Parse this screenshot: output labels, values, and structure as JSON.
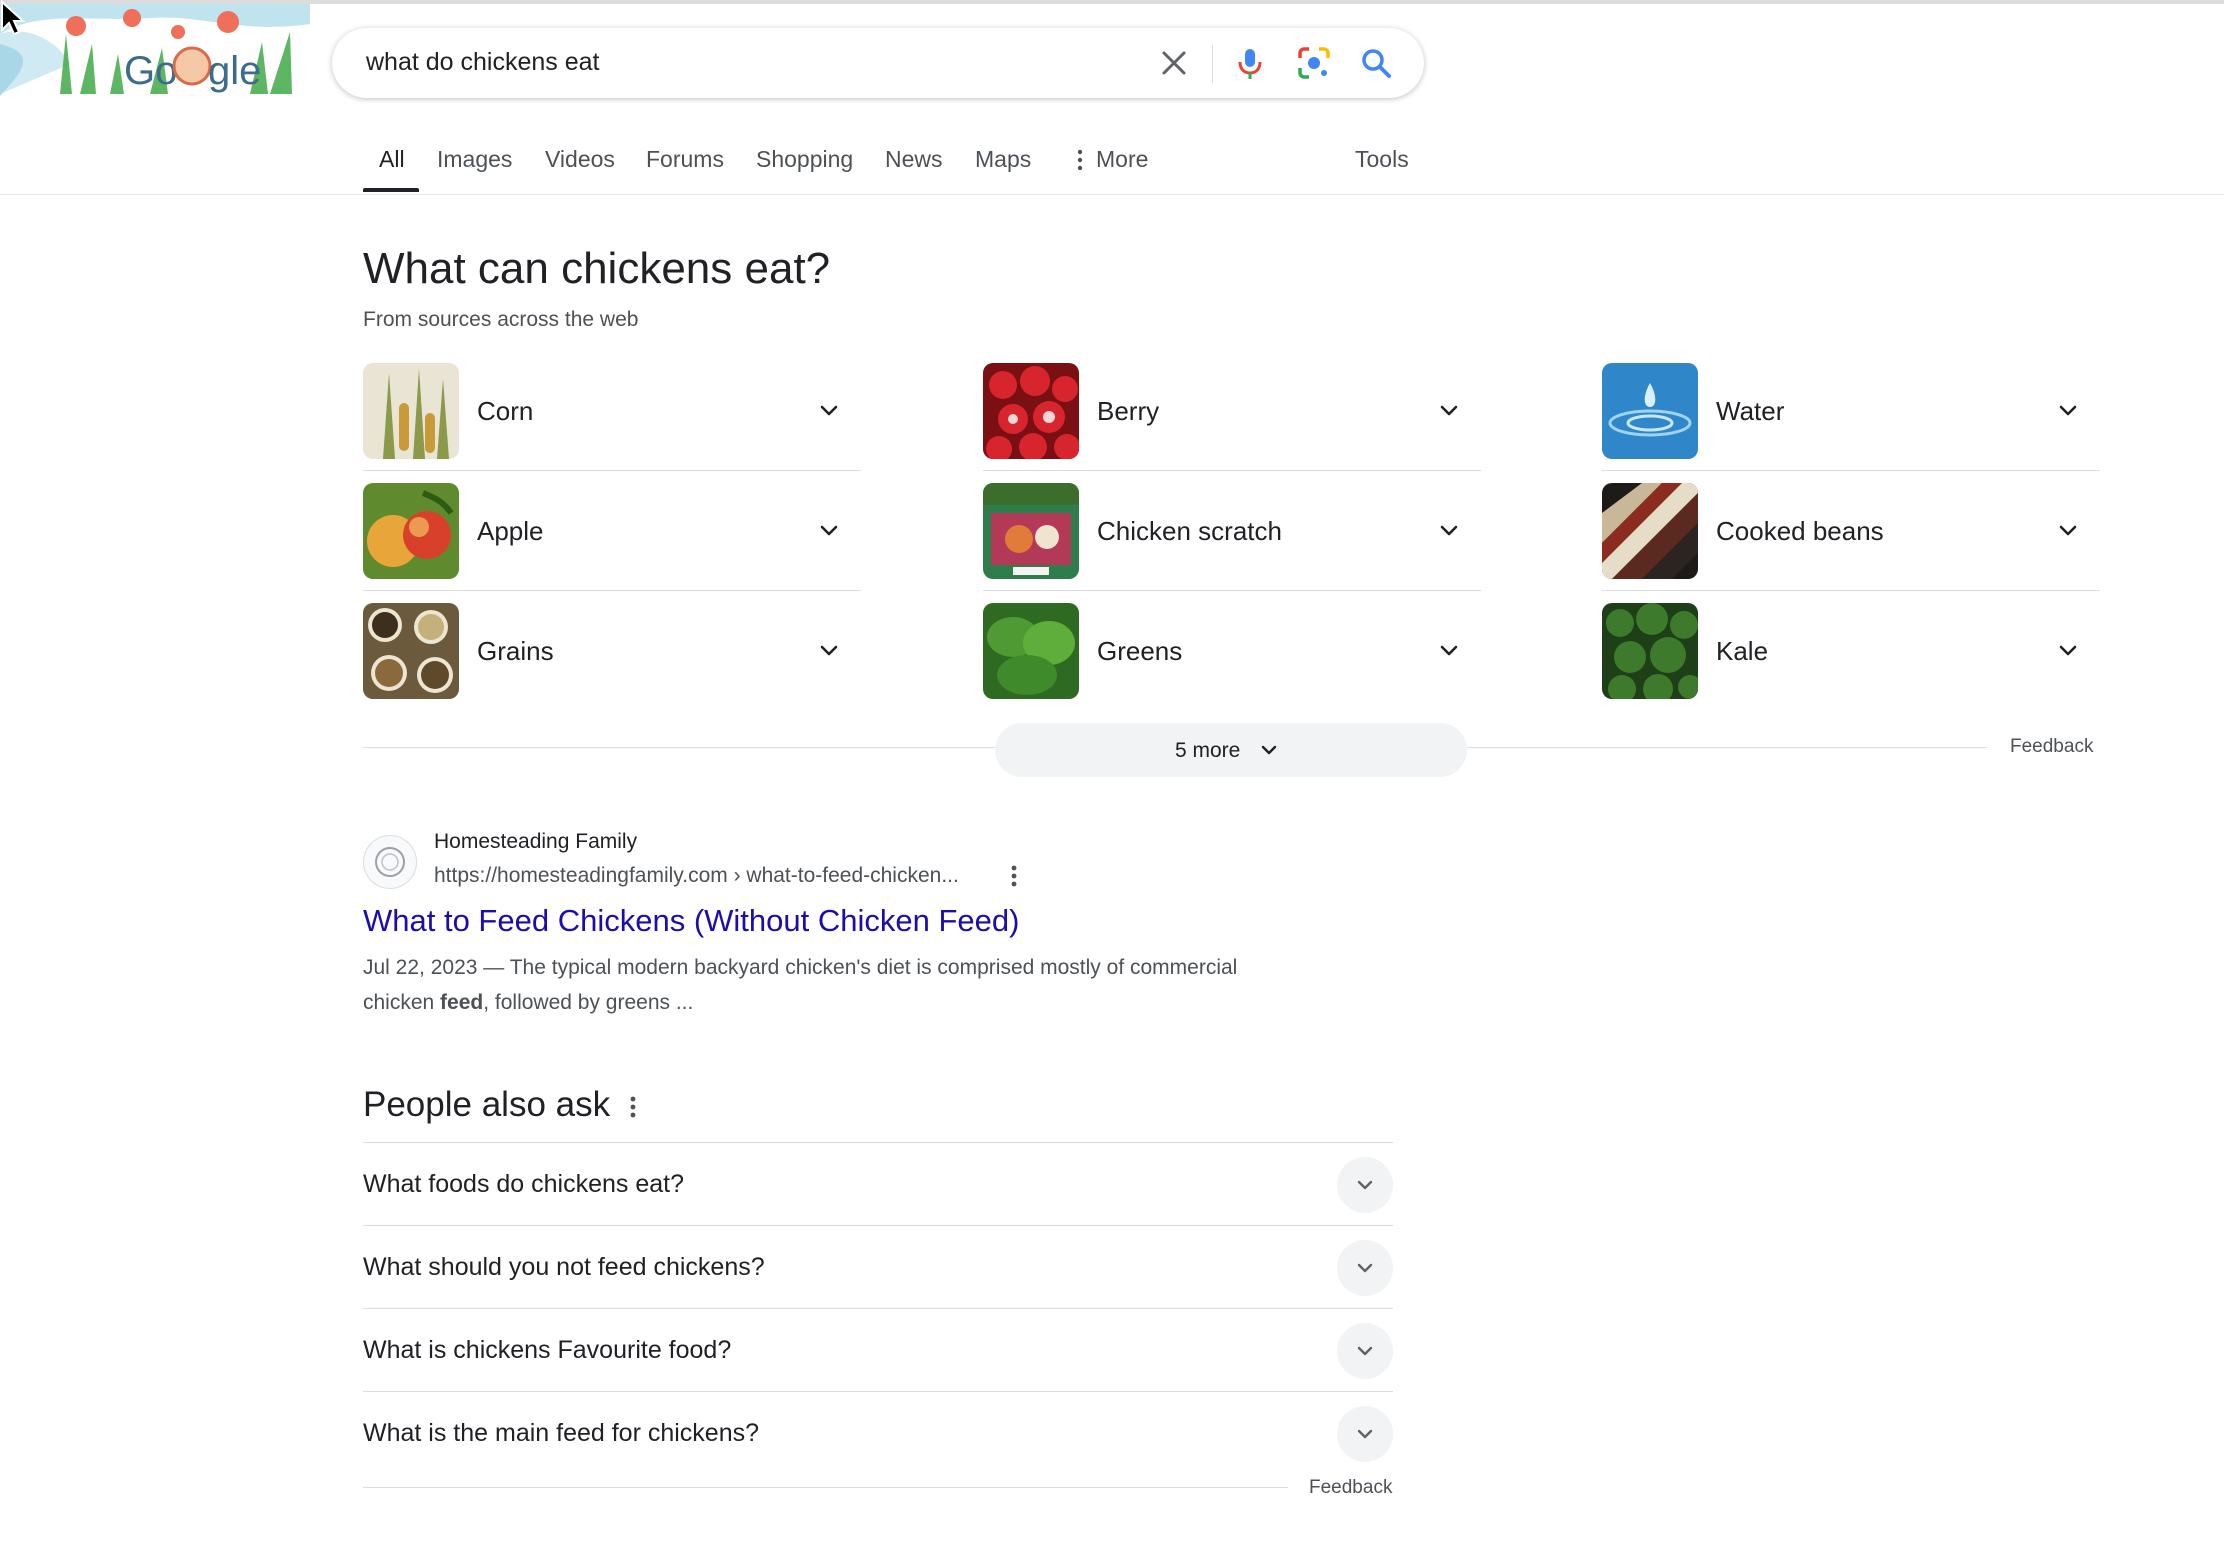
{
  "search": {
    "query": "what do chickens eat"
  },
  "tabs": [
    {
      "label": "All"
    },
    {
      "label": "Images"
    },
    {
      "label": "Videos"
    },
    {
      "label": "Forums"
    },
    {
      "label": "Shopping"
    },
    {
      "label": "News"
    },
    {
      "label": "Maps"
    },
    {
      "label": "More"
    }
  ],
  "tools_label": "Tools",
  "icons": {
    "logo": "google-doodle-logo",
    "clear": "close-icon",
    "voice": "microphone-icon",
    "lens": "camera-lens-icon",
    "search": "search-icon",
    "expand": "chevron-down-icon",
    "more_options": "vertical-dots-icon"
  },
  "colors": {
    "link": "#1a0dab",
    "mic_blue": "#4285f4",
    "mic_red": "#ea4335",
    "lens_yellow": "#fbbc04",
    "lens_green": "#34a853"
  },
  "foods_panel": {
    "title": "What can chickens eat?",
    "subtitle": "From sources across the web",
    "items": [
      {
        "label": "Corn"
      },
      {
        "label": "Berry"
      },
      {
        "label": "Water"
      },
      {
        "label": "Apple"
      },
      {
        "label": "Chicken scratch"
      },
      {
        "label": "Cooked beans"
      },
      {
        "label": "Grains"
      },
      {
        "label": "Greens"
      },
      {
        "label": "Kale"
      }
    ],
    "more_label": "5 more",
    "feedback": "Feedback"
  },
  "result": {
    "site_name": "Homesteading Family",
    "url": "https://homesteadingfamily.com › what-to-feed-chicken...",
    "title": "What to Feed Chickens (Without Chicken Feed)",
    "date": "Jul 22, 2023",
    "snippet_a": " — The typical modern backyard chicken's diet is comprised mostly of commercial chicken ",
    "snippet_bold": "feed",
    "snippet_b": ", followed by greens ..."
  },
  "people_also_ask": {
    "heading": "People also ask",
    "questions": [
      {
        "q": "What foods do chickens eat?"
      },
      {
        "q": "What should you not feed chickens?"
      },
      {
        "q": "What is chickens Favourite food?"
      },
      {
        "q": "What is the main feed for chickens?"
      }
    ],
    "feedback": "Feedback"
  }
}
